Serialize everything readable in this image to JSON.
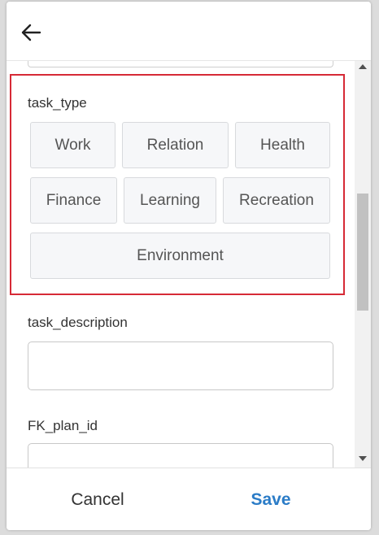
{
  "header": {
    "back_icon": "arrow-left-icon"
  },
  "form": {
    "task_type": {
      "label": "task_type",
      "options": [
        "Work",
        "Relation",
        "Health",
        "Finance",
        "Learning",
        "Recreation",
        "Environment"
      ]
    },
    "task_description": {
      "label": "task_description",
      "value": ""
    },
    "fk_plan_id": {
      "label": "FK_plan_id",
      "value": ""
    }
  },
  "footer": {
    "cancel_label": "Cancel",
    "save_label": "Save"
  },
  "colors": {
    "highlight_border": "#d62a36",
    "save_text": "#2b7cc7"
  }
}
